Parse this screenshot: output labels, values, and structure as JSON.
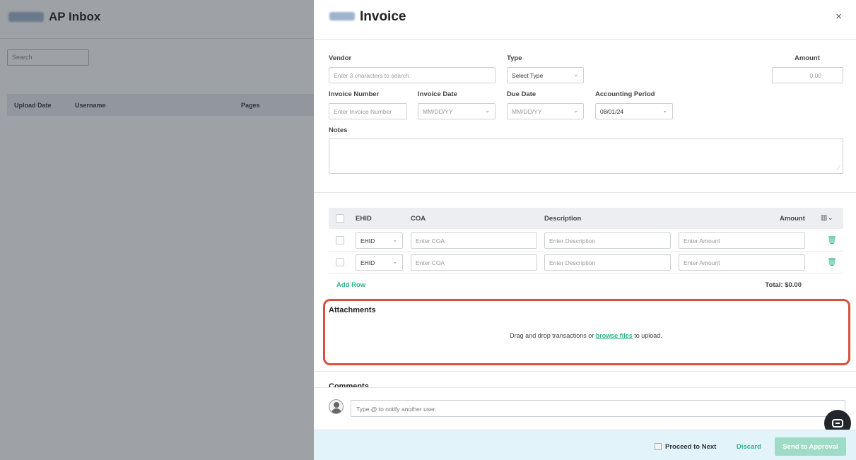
{
  "background": {
    "title": "AP Inbox",
    "search_placeholder": "Search",
    "columns": [
      "Upload Date",
      "Username",
      "Pages"
    ]
  },
  "panel": {
    "title": "Invoice",
    "close_symbol": "×"
  },
  "form": {
    "vendor_label": "Vendor",
    "vendor_placeholder": "Enter 3 characters to search.",
    "type_label": "Type",
    "type_value": "Select Type",
    "amount_label": "Amount",
    "amount_value": "0.00",
    "invoice_number_label": "Invoice Number",
    "invoice_number_placeholder": "Enter Invoice Number",
    "invoice_date_label": "Invoice Date",
    "invoice_date_placeholder": "MM/DD/YY",
    "due_date_label": "Due Date",
    "due_date_placeholder": "MM/DD/YY",
    "accounting_period_label": "Accounting Period",
    "accounting_period_value": "08/01/24",
    "notes_label": "Notes"
  },
  "line_items": {
    "headers": {
      "ehid": "EHID",
      "coa": "COA",
      "description": "Description",
      "amount": "Amount"
    },
    "rows": [
      {
        "ehid": "EHID",
        "coa_placeholder": "Enter COA",
        "description_placeholder": "Enter Description",
        "amount_placeholder": "Enter Amount"
      },
      {
        "ehid": "EHID",
        "coa_placeholder": "Enter COA",
        "description_placeholder": "Enter Description",
        "amount_placeholder": "Enter Amount"
      }
    ],
    "add_row_label": "Add Row",
    "total_label": "Total: $0.00"
  },
  "attachments": {
    "title": "Attachments",
    "drop_prefix": "Drag and drop transactions or ",
    "browse_link": "browse files",
    "drop_suffix": " to upload.",
    "highlight_color": "#d9503f"
  },
  "comments": {
    "title": "Comments",
    "input_placeholder": "Type @ to notify another user."
  },
  "footer": {
    "proceed_label": "Proceed to Next",
    "discard_label": "Discard",
    "send_label": "Send to Approval"
  },
  "colors": {
    "accent": "#2fb388",
    "footer_bg": "#e3f3fa",
    "send_button": "#9fdcc8"
  }
}
